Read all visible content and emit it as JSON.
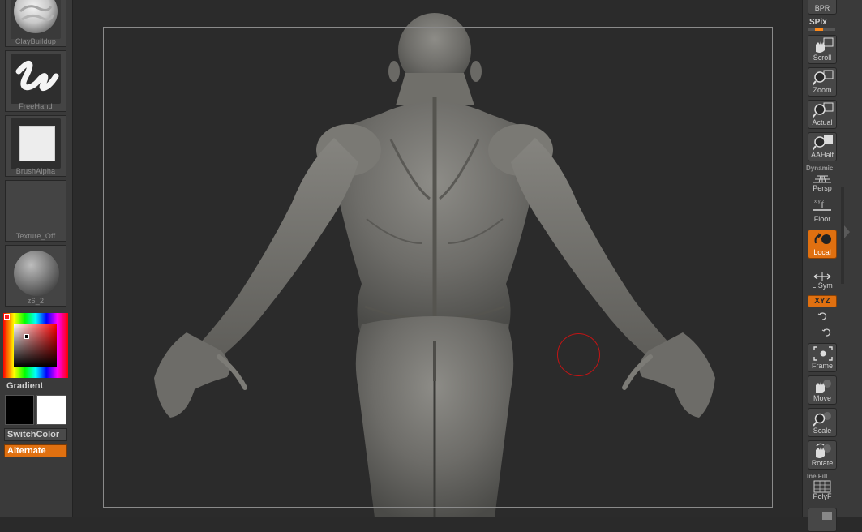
{
  "left_shelf": {
    "brush": {
      "label": "ClayBuildup"
    },
    "stroke": {
      "label": "FreeHand"
    },
    "alpha": {
      "label": "BrushAlpha"
    },
    "texture": {
      "label": "Texture_Off"
    },
    "material": {
      "label": "z6_2"
    },
    "gradient_label": "Gradient",
    "main_color": "#000000",
    "secondary_color": "#ffffff",
    "switchcolor_label": "SwitchColor",
    "alternate_label": "Alternate"
  },
  "right_shelf": {
    "bpr_label": "BPR",
    "spix_label": "SPix",
    "buttons": [
      {
        "label": "Scroll",
        "icon": "scroll-hand-icon"
      },
      {
        "label": "Zoom",
        "icon": "zoom-magnifier-icon"
      },
      {
        "label": "Actual",
        "icon": "actual-size-icon"
      },
      {
        "label": "AAHalf",
        "icon": "aahalf-icon"
      },
      {
        "label": "Persp",
        "icon": "perspective-grid-icon",
        "caption": "Dynamic"
      },
      {
        "label": "Floor",
        "icon": "floor-grid-icon"
      },
      {
        "label": "Local",
        "icon": "local-pivot-icon",
        "active": true
      },
      {
        "label": "L.Sym",
        "icon": "local-symmetry-icon"
      },
      {
        "label": "Frame",
        "icon": "frame-icon"
      },
      {
        "label": "Move",
        "icon": "move-hand-icon"
      },
      {
        "label": "Scale",
        "icon": "scale-magnifier-icon"
      },
      {
        "label": "Rotate",
        "icon": "rotate-icon"
      },
      {
        "label": "PolyF",
        "icon": "polyframe-icon",
        "caption": "Ine Fill"
      }
    ],
    "xyz_label": "XYZ"
  },
  "colors": {
    "accent": "#e07010",
    "canvas": "#2b2b2b",
    "shelf": "#3a3a3a",
    "brush_cursor": "#c21414"
  }
}
